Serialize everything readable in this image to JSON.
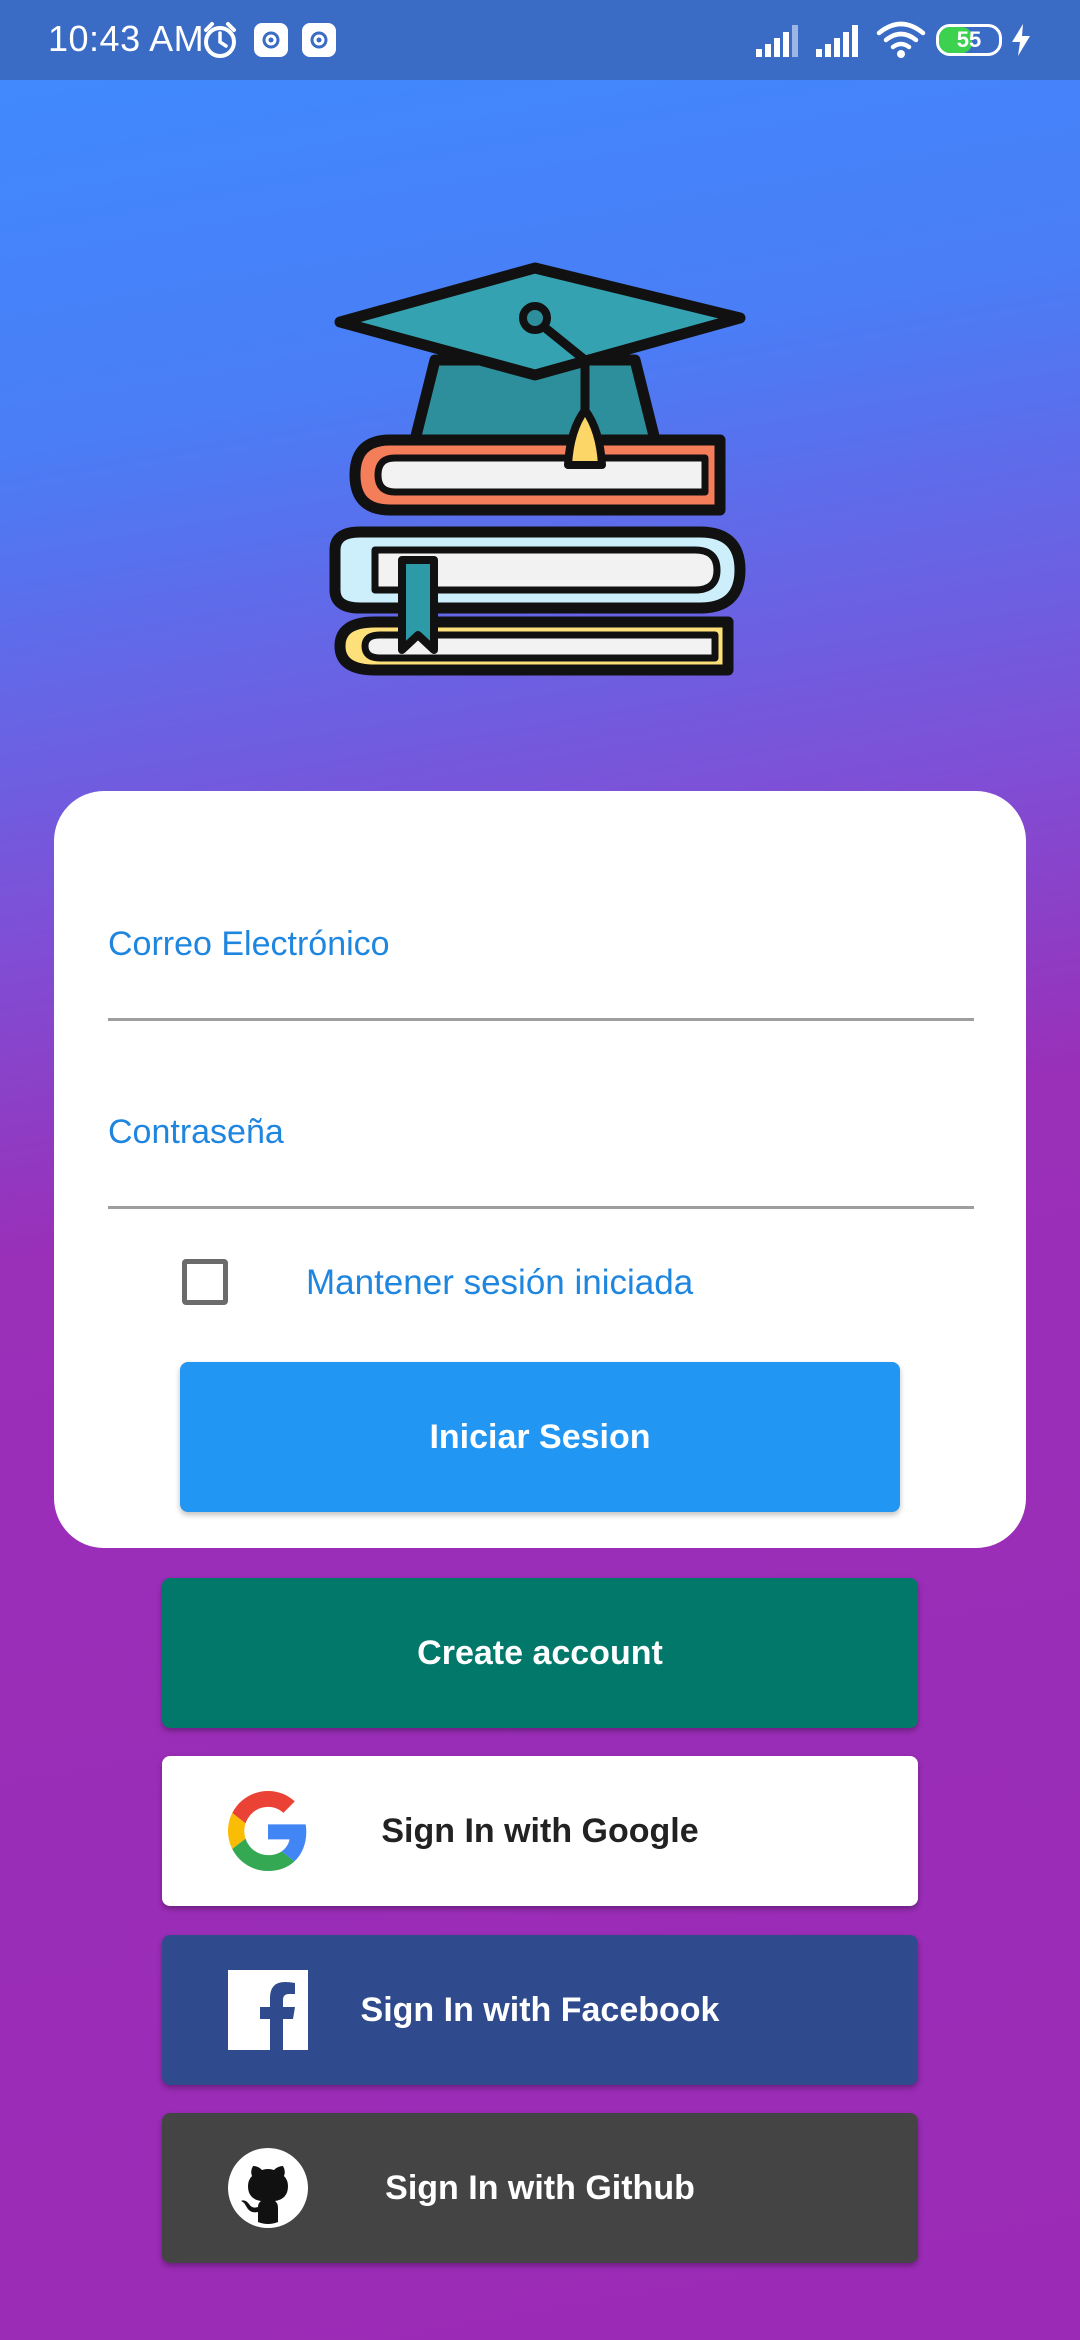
{
  "status_bar": {
    "time": "10:43 AM",
    "battery": "55",
    "battery_level_percent": 55
  },
  "login_card": {
    "email_label": "Correo Electrónico",
    "password_label": "Contraseña",
    "remember_label": "Mantener sesión iniciada",
    "remember_checked": false,
    "login_button": "Iniciar Sesion"
  },
  "buttons": {
    "create_account": "Create account",
    "google": "Sign In with Google",
    "facebook": "Sign In with Facebook",
    "github": "Sign In with Github"
  },
  "colors": {
    "accent_blue": "#2196f3",
    "label_blue": "#1f86e0",
    "create_green": "#02786b",
    "facebook_blue": "#2f4b8d",
    "github_gray": "#444444"
  },
  "icons": {
    "logo": "graduation-cap-books-icon",
    "google": "google-g-icon",
    "facebook": "facebook-f-icon",
    "github": "github-octocat-icon"
  }
}
